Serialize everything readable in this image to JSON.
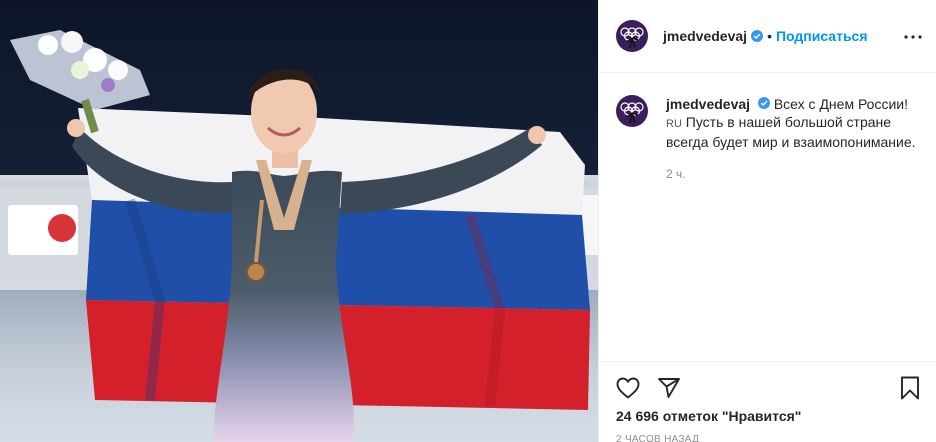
{
  "post": {
    "username": "jmedvedevaj",
    "follow_label": "Подписаться",
    "separator": "•",
    "caption_line1": "Всех с Днем России!",
    "caption_rest": "Пусть в нашей большой стране всегда будет мир и взаимопонимание.",
    "flag_emoji_text": "RU",
    "caption_time": "2 ч.",
    "likes": "24 696 отметок \"Нравится\"",
    "posted_ago": "2 ЧАСОВ НАЗАД"
  },
  "colors": {
    "link_blue": "#0095f6",
    "verified_blue": "#3897f0",
    "muted_text": "#8e8e8e",
    "divider": "#efefef",
    "flag_white": "#f2f2f4",
    "flag_blue": "#1f4fa8",
    "flag_red": "#d4202b"
  },
  "icons": [
    "verified-badge-icon",
    "more-options-icon",
    "heart-icon",
    "share-icon",
    "bookmark-icon",
    "olympic-rings-icon"
  ]
}
